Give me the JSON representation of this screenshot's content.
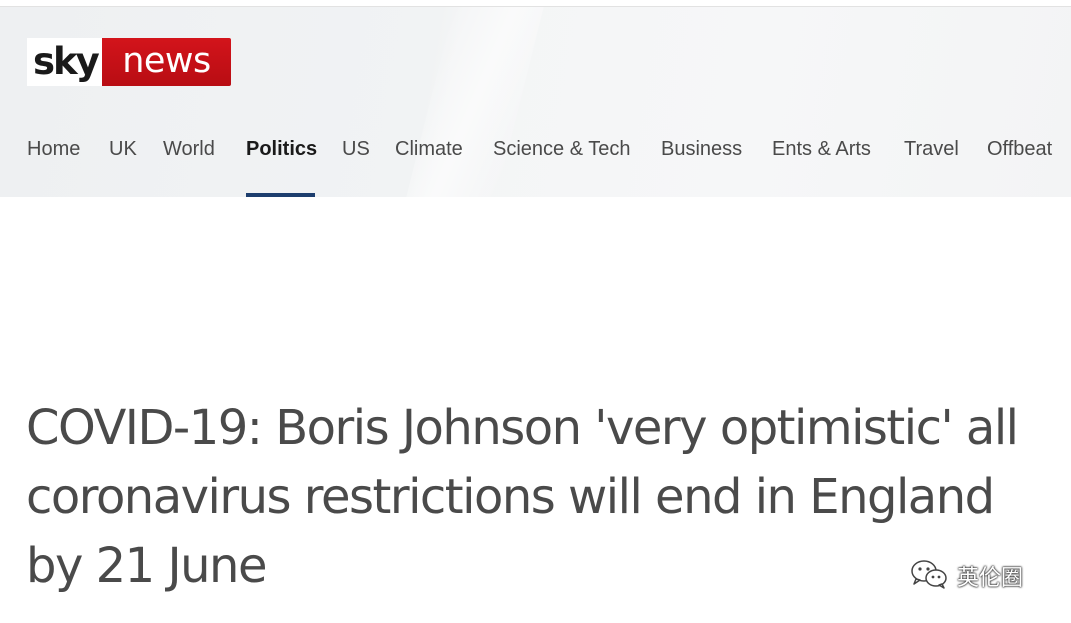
{
  "logo": {
    "sky": "sky",
    "news": "news"
  },
  "nav": {
    "items": [
      {
        "label": "Home"
      },
      {
        "label": "UK"
      },
      {
        "label": "World"
      },
      {
        "label": "Politics",
        "active": true
      },
      {
        "label": "US"
      },
      {
        "label": "Climate"
      },
      {
        "label": "Science & Tech"
      },
      {
        "label": "Business"
      },
      {
        "label": "Ents & Arts"
      },
      {
        "label": "Travel"
      },
      {
        "label": "Offbeat"
      }
    ]
  },
  "article": {
    "headline": "COVID-19: Boris Johnson 'very optimistic' all coronavirus restrictions will end in England by 21 June"
  },
  "watermark": {
    "label": "英伦圈",
    "icon": "wechat-icon"
  },
  "colors": {
    "brand_red": "#c8101a",
    "nav_active_underline": "#1d3e6e",
    "text": "#4a4a4a"
  }
}
